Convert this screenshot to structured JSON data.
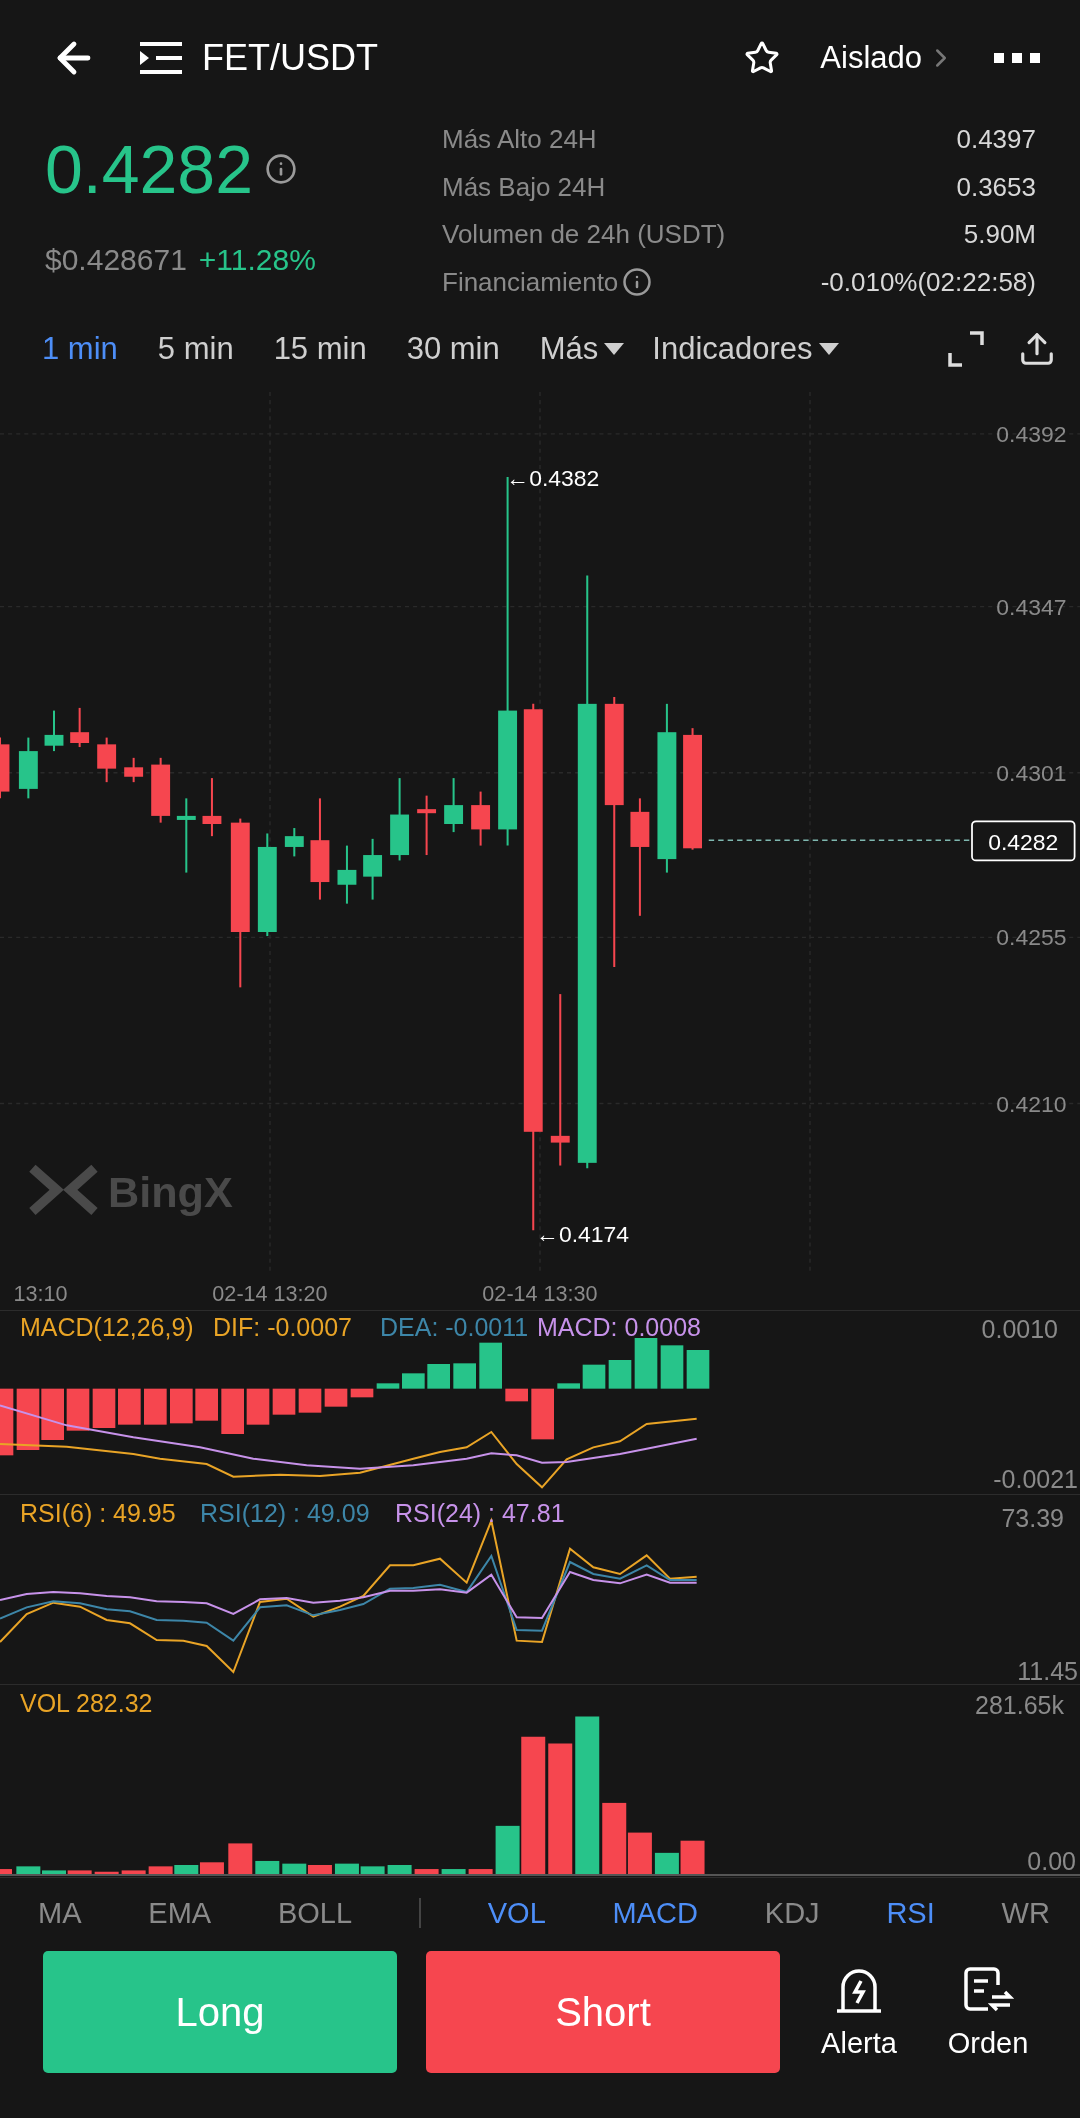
{
  "header": {
    "title": "FET/USDT",
    "favorite": false,
    "margin_mode": "Aislado"
  },
  "price": {
    "last": "0.4282",
    "usd": "$0.428671",
    "change": "+11.28%"
  },
  "stats": [
    {
      "label": "Más Alto 24H",
      "value": "0.4397",
      "info": false
    },
    {
      "label": "Más Bajo 24H",
      "value": "0.3653",
      "info": false
    },
    {
      "label": "Volumen de 24h (USDT)",
      "value": "5.90M",
      "info": false
    },
    {
      "label": "Financiamiento",
      "value": "-0.010%(02:22:58)",
      "info": true
    }
  ],
  "intervals": [
    {
      "label": "1 min",
      "selected": true
    },
    {
      "label": "5 min",
      "selected": false
    },
    {
      "label": "15 min",
      "selected": false
    },
    {
      "label": "30 min",
      "selected": false
    }
  ],
  "menus": [
    {
      "label": "Más"
    },
    {
      "label": "Indicadores"
    }
  ],
  "chart": {
    "y_labels": [
      "0.4392",
      "0.4347",
      "0.4301",
      "0.4255",
      "0.4210"
    ],
    "high_marker": "←0.4382",
    "low_marker": "←0.4174",
    "last_price": "0.4282",
    "time_labels": [
      "13:10",
      "02-14 13:20",
      "02-14 13:30"
    ],
    "watermark": "BingX"
  },
  "macd": {
    "labels": [
      {
        "text": "MACD(12,26,9)",
        "color": "#e9a426"
      },
      {
        "text": "DIF: -0.0007",
        "color": "#e9a426"
      },
      {
        "text": "DEA: -0.0011",
        "color": "#3d86a8"
      },
      {
        "text": "MACD: 0.0008",
        "color": "#c792ea"
      }
    ],
    "axis": [
      "0.0010",
      "-0.0021"
    ]
  },
  "rsi": {
    "labels": [
      {
        "text": "RSI(6) : 49.95",
        "color": "#e9a426"
      },
      {
        "text": "RSI(12) : 49.09",
        "color": "#3d86a8"
      },
      {
        "text": "RSI(24) : 47.81",
        "color": "#c792ea"
      }
    ],
    "axis": [
      "73.39",
      "11.45"
    ]
  },
  "vol": {
    "label": "VOL 282.32",
    "axis": [
      "281.65k",
      "0.00"
    ]
  },
  "main_indicator_tabs": [
    {
      "label": "MA",
      "selected": false
    },
    {
      "label": "EMA",
      "selected": false
    },
    {
      "label": "BOLL",
      "selected": false
    }
  ],
  "sub_indicator_tabs": [
    {
      "label": "VOL",
      "selected": true
    },
    {
      "label": "MACD",
      "selected": true
    },
    {
      "label": "KDJ",
      "selected": false
    },
    {
      "label": "RSI",
      "selected": true
    },
    {
      "label": "WR",
      "selected": false
    }
  ],
  "actions": [
    {
      "label": "Long",
      "kind": "long"
    },
    {
      "label": "Short",
      "kind": "short"
    }
  ],
  "tools": [
    {
      "label": "Alerta",
      "kind": "alert"
    },
    {
      "label": "Orden",
      "kind": "order"
    }
  ]
}
